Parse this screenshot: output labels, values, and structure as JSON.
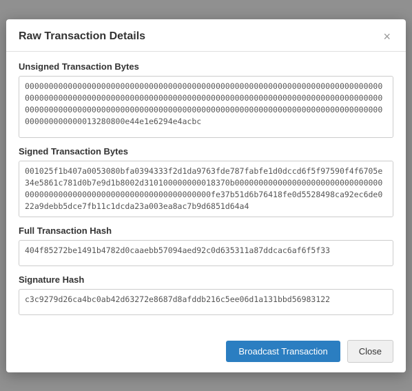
{
  "modal": {
    "title": "Raw Transaction Details",
    "close_label": "×"
  },
  "sections": {
    "unsigned_label": "Unsigned Transaction Bytes",
    "unsigned_value": "000000000000000000000000000000000000000000000000000000000000000000000000000000000000000000000000000000000000000000000000000000000000000000000000000000000000000000000000000000000000000000000000000000000000000000000000000000000000000000000013280800e44e1e6294e4acbc",
    "signed_label": "Signed Transaction Bytes",
    "signed_value": "001025f1b407a0053080bfa0394333f2d1da9763fde787fabfe1d0dccd6f5f97590f4f6705e34e5861c781d0b7e9d1b8002d310100000000018370b0000000000000000000000000000000000000000000000000000000000000000000000fe37b51d6b76418fe0d5528498ca92ec6de022a9debb5dce7fb11c1dcda23a003ea8ac7b9d6851d64a4",
    "full_hash_label": "Full Transaction Hash",
    "full_hash_value": "404f85272be1491b4782d0caaebb57094aed92c0d635311a87ddcac6af6f5f33",
    "sig_hash_label": "Signature Hash",
    "sig_hash_value": "c3c9279d26ca4bc0ab42d63272e8687d8afddb216c5ee06d1a131bbd56983122"
  },
  "footer": {
    "broadcast_label": "Broadcast Transaction",
    "close_label": "Close"
  }
}
